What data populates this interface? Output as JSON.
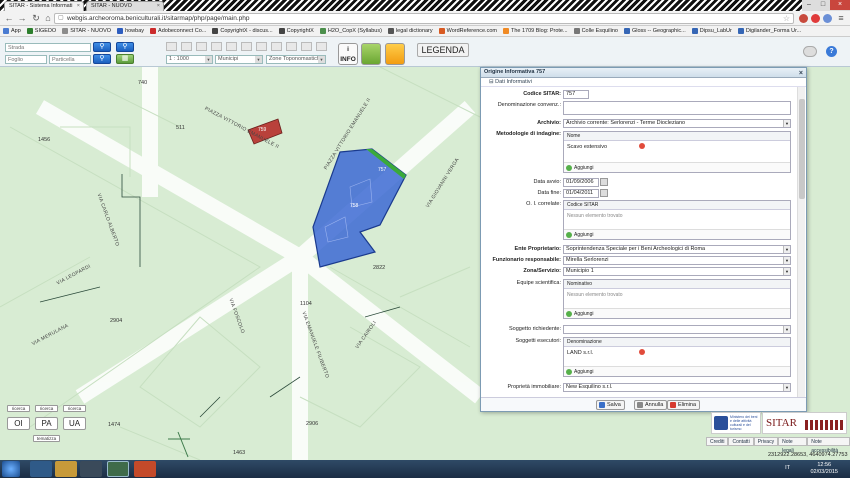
{
  "browser": {
    "tabs": [
      {
        "title": "SITAR - Sistema Informati"
      },
      {
        "title": "SITAR - NUOVO"
      }
    ],
    "url": "webgis.archeoroma.beniculturali.it/sitarmap/php/page/main.php",
    "bookmarks": [
      {
        "label": "App",
        "color": "#4a7bd1"
      },
      {
        "label": "SIGEDO",
        "color": "#2d7f2d"
      },
      {
        "label": "SITAR - NUOVO",
        "color": "#8c8c8c"
      },
      {
        "label": "howbay",
        "color": "#2d5dbf"
      },
      {
        "label": "Adobeconnect Co...",
        "color": "#cc2b2b"
      },
      {
        "label": "CopyrightX - discus...",
        "color": "#444444"
      },
      {
        "label": "CopyrightX",
        "color": "#444444"
      },
      {
        "label": "H2O_CopX (Syllabus)",
        "color": "#4c8f4c"
      },
      {
        "label": "legal dictionary",
        "color": "#555555"
      },
      {
        "label": "WordReference.com",
        "color": "#d85a22"
      },
      {
        "label": "The 1709 Blog: Prote...",
        "color": "#f08a24"
      },
      {
        "label": "Colle Esquilino",
        "color": "#777777"
      },
      {
        "label": "Gloss -- Geographic...",
        "color": "#3566b5"
      },
      {
        "label": "Dipsu_LabUr",
        "color": "#3566b5"
      },
      {
        "label": "Digilander_Forma Ur...",
        "color": "#3566b5"
      }
    ]
  },
  "toolbar": {
    "search_street_placeholder": "Strada",
    "search_sheet_placeholder": "Foglio",
    "search_parcel_placeholder": "Particella",
    "scale_value": "1 : 1000",
    "municipality_placeholder": "Municipi",
    "toponym_placeholder": "Zone Toponomastiche",
    "info_label": "i\nINFO",
    "legend_label": "LEGENDA"
  },
  "map": {
    "labels": [
      {
        "text": "740"
      },
      {
        "text": "511"
      },
      {
        "text": "1456"
      },
      {
        "text": "2822"
      },
      {
        "text": "1104"
      },
      {
        "text": "2904"
      },
      {
        "text": "1474"
      },
      {
        "text": "2906"
      },
      {
        "text": "1463"
      }
    ],
    "roads": [
      {
        "text": "PIAZZA VITTORIO EMANUELE II"
      },
      {
        "text": "PIAZZA VITTORIO EMANUELE II"
      },
      {
        "text": "VIA CARLO ALBERTO"
      },
      {
        "text": "VIA LEOPARDI"
      },
      {
        "text": "VIA MERULANA"
      },
      {
        "text": "VIA EMANUELE FILIBERTO"
      },
      {
        "text": "VIA CAIROLI"
      },
      {
        "text": "VIA FOSCOLO"
      },
      {
        "text": "VIA GIOVANNI VERGA"
      }
    ],
    "feature_ids": [
      "757",
      "758",
      "759"
    ],
    "controls": {
      "small": [
        "ricerca",
        "ricerca",
        "ricerca"
      ],
      "big": [
        "OI",
        "PA",
        "UA"
      ],
      "tematizza": "tematizza"
    }
  },
  "dialog": {
    "title": "Origine Informativa 757",
    "section": "Dati Informativi",
    "fields": {
      "codice_sitar": {
        "label": "Codice SITAR:",
        "value": "757"
      },
      "denominazione": {
        "label": "Denominazione convenz.:",
        "value": ""
      },
      "archivio": {
        "label": "Archivio:",
        "value": "Archivio corrente: Serlorenzi - Terme Diocleziano"
      },
      "metodologie": {
        "label": "Metodologie di indagine:",
        "header": "Nome",
        "rows": [
          "Scavo estensivo"
        ],
        "add": "Aggiungi"
      },
      "data_avvio": {
        "label": "Data avvio:",
        "value": "01/09/2006"
      },
      "data_fine": {
        "label": "Data fine:",
        "value": "01/04/2011"
      },
      "oi_correlate": {
        "label": "O. I. correlate:",
        "header": "Codice SITAR",
        "empty": "Nessun elemento trovato",
        "add": "Aggiungi"
      },
      "ente": {
        "label": "Ente Proprietario:",
        "value": "Soprintendenza Speciale per i Beni Archeologici di Roma"
      },
      "funzionario": {
        "label": "Funzionario responsabile:",
        "value": "Mirella Serlorenzi"
      },
      "zona": {
        "label": "Zona/Servizio:",
        "value": "Municipio 1"
      },
      "equipe": {
        "label": "Equipe scientifica:",
        "header": "Nominativo",
        "empty": "Nessun elemento trovato",
        "add": "Aggiungi"
      },
      "soggetto_richiedente": {
        "label": "Soggetto richiedente:",
        "value": ""
      },
      "soggetti_esecutori": {
        "label": "Soggetti esecutori:",
        "header": "Denominazione",
        "rows": [
          "LAND s.r.l."
        ],
        "add": "Aggiungi"
      },
      "proprieta": {
        "label": "Proprietà immobiliare:",
        "value": "New Esquilino s.r.l."
      }
    },
    "buttons": {
      "save": "Salva",
      "cancel": "Annulla",
      "delete": "Elimina"
    }
  },
  "footer": {
    "links": [
      "Crediti",
      "Contatti",
      "Privacy",
      "Note legali",
      "Note accessibilità"
    ],
    "coords": "2312922.28653, 4640974.27753",
    "logo_text": "SITAR",
    "ministry_text": "Ministero dei beni e delle attività culturali e del turismo"
  },
  "taskbar": {
    "lang": "IT",
    "time": "12:56",
    "date": "02/03/2015"
  }
}
